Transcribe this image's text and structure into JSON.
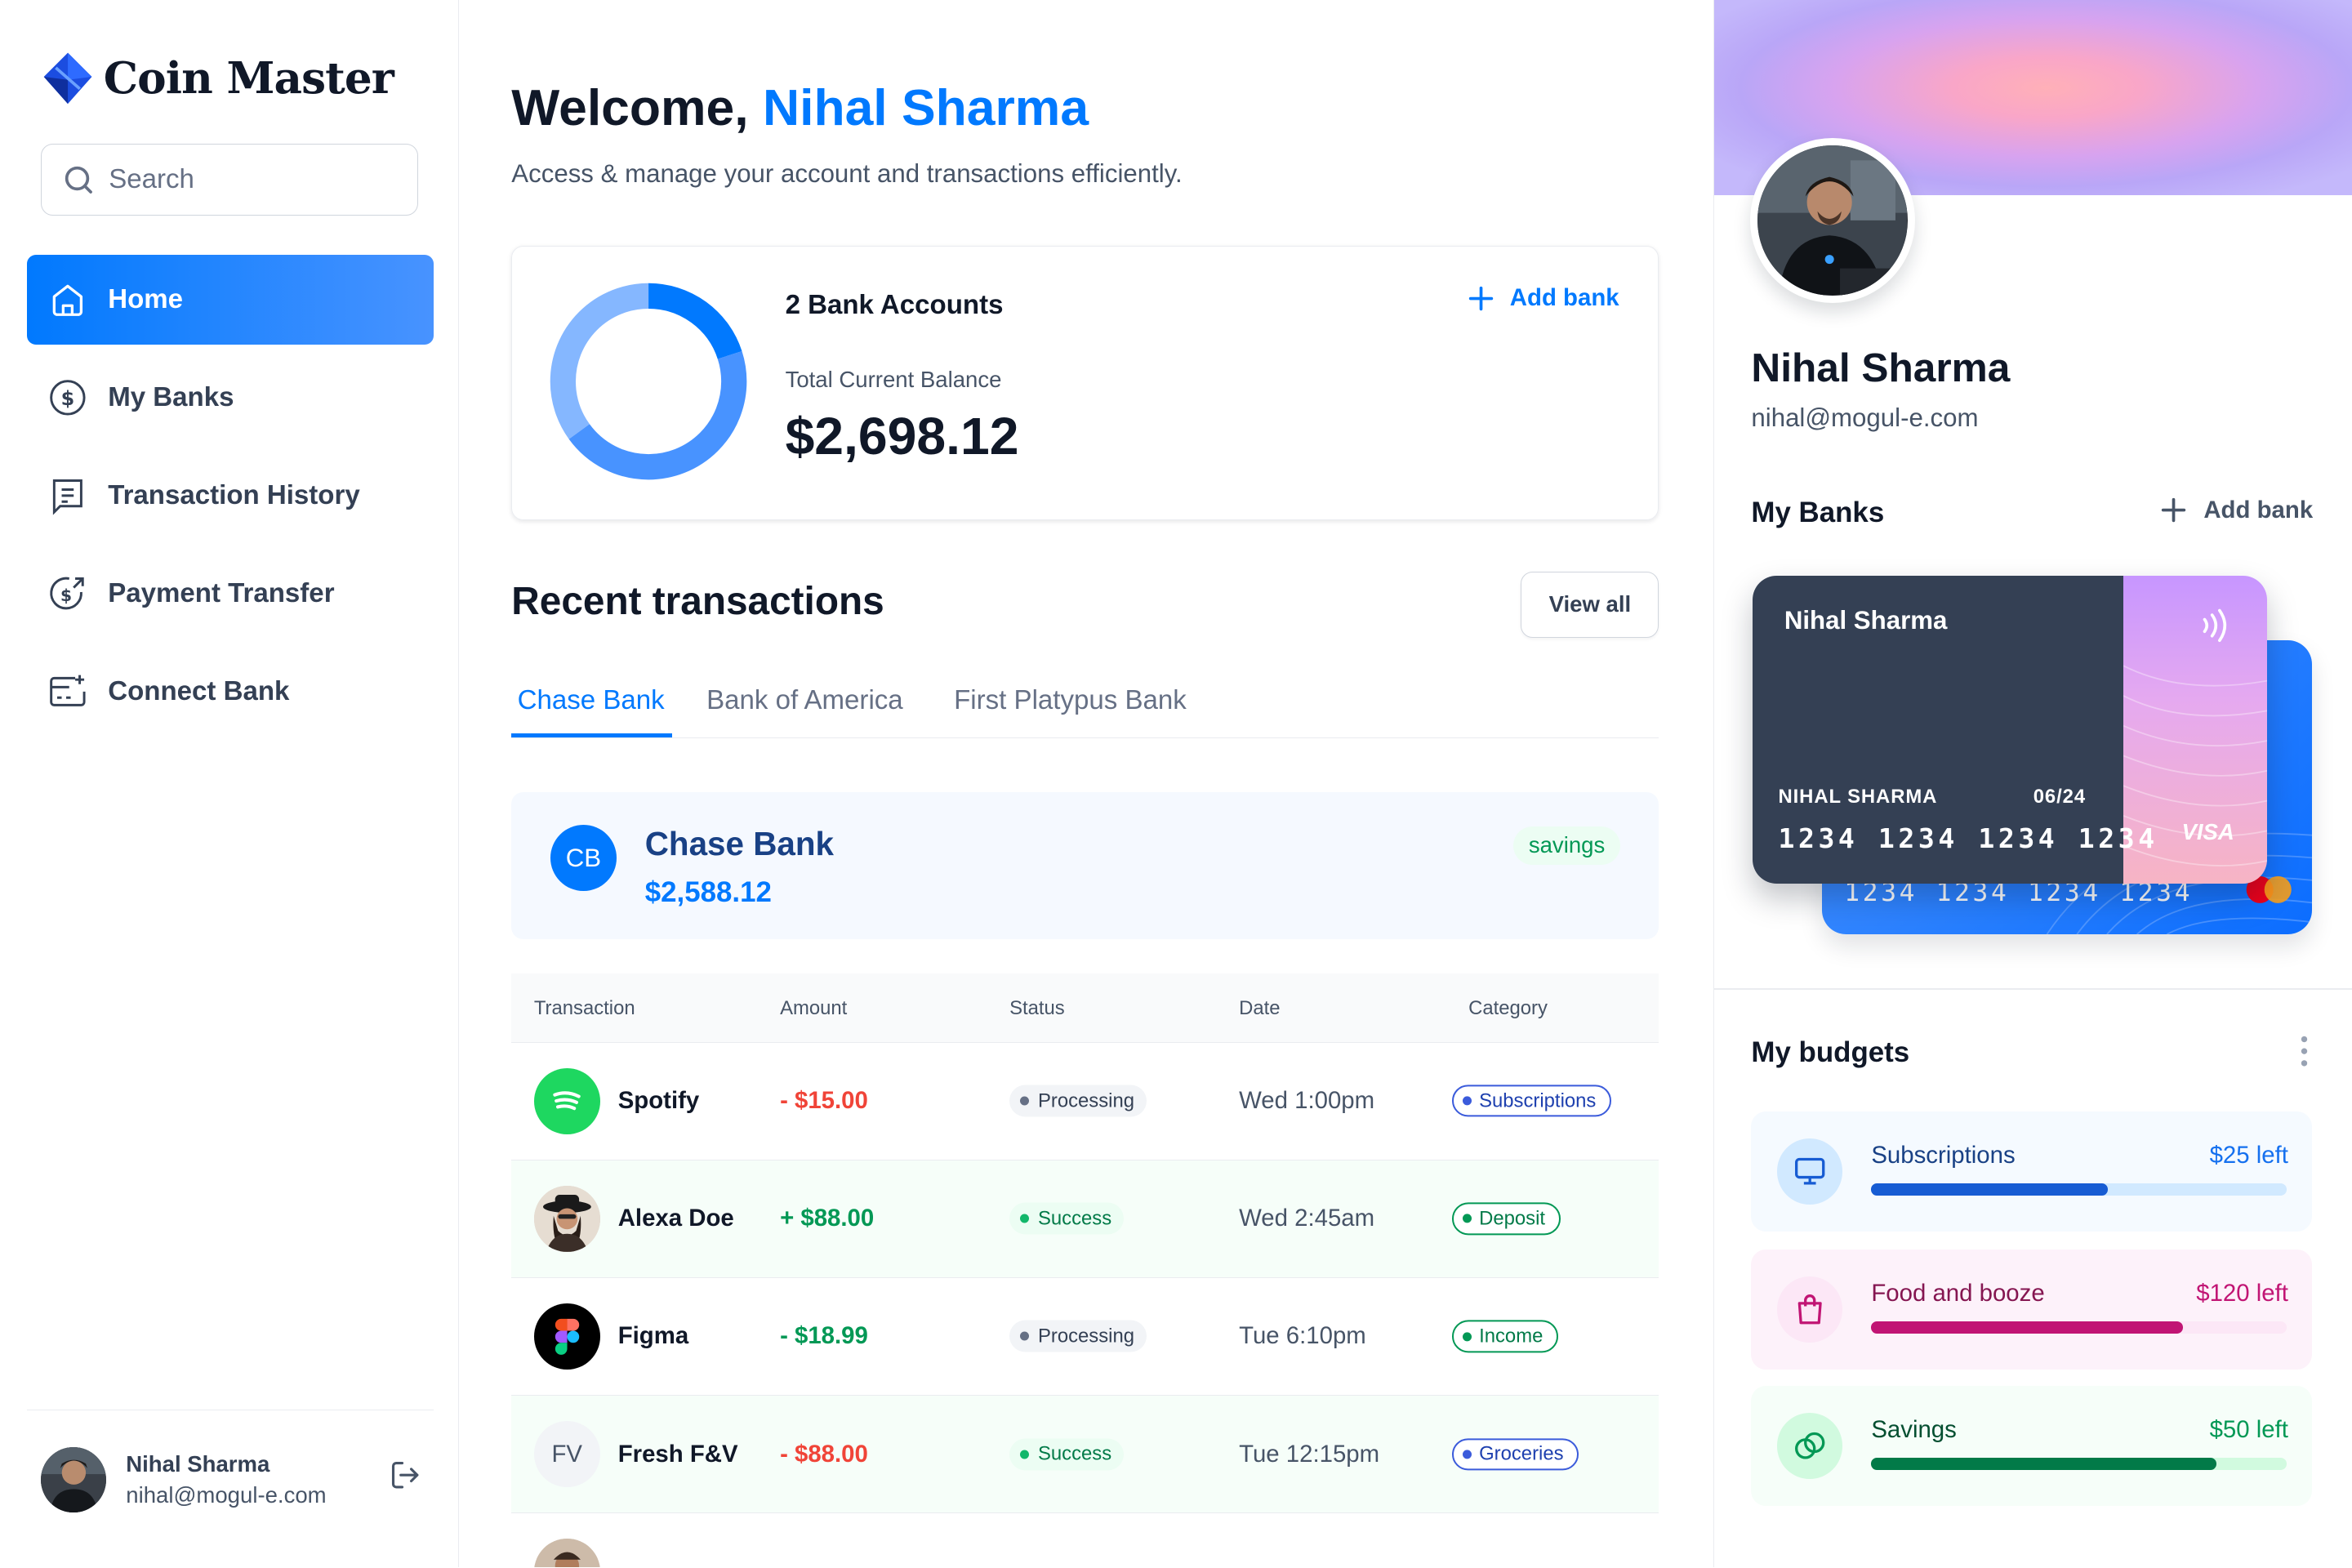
{
  "app": {
    "name": "Coin Master"
  },
  "search": {
    "placeholder": "Search"
  },
  "nav": {
    "items": [
      {
        "label": "Home",
        "icon": "home-icon",
        "active": true
      },
      {
        "label": "My Banks",
        "icon": "dollar-circle-icon"
      },
      {
        "label": "Transaction History",
        "icon": "receipt-icon"
      },
      {
        "label": "Payment Transfer",
        "icon": "money-send-icon"
      },
      {
        "label": "Connect Bank",
        "icon": "card-add-icon"
      }
    ]
  },
  "user": {
    "name": "Nihal Sharma",
    "email": "nihal@mogul-e.com"
  },
  "header": {
    "greeting": "Welcome,",
    "name": "Nihal Sharma",
    "subtitle": "Access & manage your account and transactions efficiently."
  },
  "balance": {
    "bank_count": "2 Bank Accounts",
    "label": "Total Current Balance",
    "value": "$2,698.12",
    "add_bank": "Add bank",
    "donut_shares": [
      0.2,
      0.45,
      0.35
    ],
    "donut_colors": [
      "#0179fe",
      "#4893ff",
      "#85b7ff"
    ]
  },
  "transactions": {
    "title": "Recent transactions",
    "view_all": "View all",
    "tabs": [
      "Chase Bank",
      "Bank of America",
      "First Platypus Bank"
    ],
    "active_tab": 0,
    "bank": {
      "initials": "CB",
      "name": "Chase Bank",
      "amount": "$2,588.12",
      "type": "savings"
    },
    "columns": [
      "Transaction",
      "Amount",
      "Status",
      "Date",
      "Category"
    ],
    "rows": [
      {
        "name": "Spotify",
        "amount": "- $15.00",
        "status": "Processing",
        "date": "Wed 1:00pm",
        "category": "Subscriptions"
      },
      {
        "name": "Alexa Doe",
        "amount": "+ $88.00",
        "status": "Success",
        "date": "Wed 2:45am",
        "category": "Deposit"
      },
      {
        "name": "Figma",
        "amount": "- $18.99",
        "status": "Processing",
        "date": "Tue 6:10pm",
        "category": "Income"
      },
      {
        "name": "Fresh F&V",
        "initials": "FV",
        "amount": "- $88.00",
        "status": "Success",
        "date": "Tue 12:15pm",
        "category": "Groceries"
      }
    ]
  },
  "profile": {
    "name": "Nihal Sharma",
    "email": "nihal@mogul-e.com",
    "my_banks_title": "My Banks",
    "add_bank": "Add bank",
    "card": {
      "bank_label": "Nihal Sharma",
      "holder": "NIHAL SHARMA",
      "expiry": "06/24",
      "number": "1234 1234 1234 1234",
      "brand": "VISA"
    },
    "card_back": {
      "number": "1234 1234 1234 1234"
    }
  },
  "budgets": {
    "title": "My budgets",
    "items": [
      {
        "name": "Subscriptions",
        "left": "$25 left",
        "progress": 0.57,
        "icon": "monitor-icon"
      },
      {
        "name": "Food and booze",
        "left": "$120 left",
        "progress": 0.75,
        "icon": "shopping-bag-icon"
      },
      {
        "name": "Savings",
        "left": "$50 left",
        "progress": 0.83,
        "icon": "coins-icon"
      }
    ]
  }
}
